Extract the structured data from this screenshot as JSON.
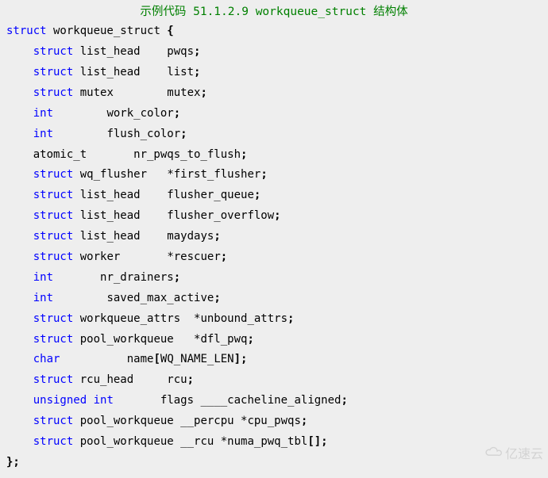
{
  "title": "示例代码 51.1.2.9 workqueue_struct 结构体",
  "lines": [
    {
      "tokens": [
        {
          "t": "struct",
          "c": "kw"
        },
        {
          "t": " workqueue_struct "
        },
        {
          "t": "{",
          "c": "punc"
        }
      ]
    },
    {
      "tokens": [
        {
          "t": "    "
        },
        {
          "t": "struct",
          "c": "kw"
        },
        {
          "t": " list_head    pwqs"
        },
        {
          "t": ";",
          "c": "punc"
        }
      ]
    },
    {
      "tokens": [
        {
          "t": "    "
        },
        {
          "t": "struct",
          "c": "kw"
        },
        {
          "t": " list_head    list"
        },
        {
          "t": ";",
          "c": "punc"
        }
      ]
    },
    {
      "tokens": [
        {
          "t": "    "
        },
        {
          "t": "struct",
          "c": "kw"
        },
        {
          "t": " mutex        mutex"
        },
        {
          "t": ";",
          "c": "punc"
        }
      ]
    },
    {
      "tokens": [
        {
          "t": "    "
        },
        {
          "t": "int",
          "c": "kw"
        },
        {
          "t": "        work_color"
        },
        {
          "t": ";",
          "c": "punc"
        }
      ]
    },
    {
      "tokens": [
        {
          "t": "    "
        },
        {
          "t": "int",
          "c": "kw"
        },
        {
          "t": "        flush_color"
        },
        {
          "t": ";",
          "c": "punc"
        }
      ]
    },
    {
      "tokens": [
        {
          "t": "    atomic_t       nr_pwqs_to_flush"
        },
        {
          "t": ";",
          "c": "punc"
        }
      ]
    },
    {
      "tokens": [
        {
          "t": "    "
        },
        {
          "t": "struct",
          "c": "kw"
        },
        {
          "t": " wq_flusher   "
        },
        {
          "t": "*",
          "c": "star"
        },
        {
          "t": "first_flusher"
        },
        {
          "t": ";",
          "c": "punc"
        }
      ]
    },
    {
      "tokens": [
        {
          "t": "    "
        },
        {
          "t": "struct",
          "c": "kw"
        },
        {
          "t": " list_head    flusher_queue"
        },
        {
          "t": ";",
          "c": "punc"
        }
      ]
    },
    {
      "tokens": [
        {
          "t": "    "
        },
        {
          "t": "struct",
          "c": "kw"
        },
        {
          "t": " list_head    flusher_overflow"
        },
        {
          "t": ";",
          "c": "punc"
        }
      ]
    },
    {
      "tokens": [
        {
          "t": "    "
        },
        {
          "t": "struct",
          "c": "kw"
        },
        {
          "t": " list_head    maydays"
        },
        {
          "t": ";",
          "c": "punc"
        }
      ]
    },
    {
      "tokens": [
        {
          "t": "    "
        },
        {
          "t": "struct",
          "c": "kw"
        },
        {
          "t": " worker       "
        },
        {
          "t": "*",
          "c": "star"
        },
        {
          "t": "rescuer"
        },
        {
          "t": ";",
          "c": "punc"
        }
      ]
    },
    {
      "tokens": [
        {
          "t": "    "
        },
        {
          "t": "int",
          "c": "kw"
        },
        {
          "t": "       nr_drainers"
        },
        {
          "t": ";",
          "c": "punc"
        }
      ]
    },
    {
      "tokens": [
        {
          "t": "    "
        },
        {
          "t": "int",
          "c": "kw"
        },
        {
          "t": "        saved_max_active"
        },
        {
          "t": ";",
          "c": "punc"
        }
      ]
    },
    {
      "tokens": [
        {
          "t": "    "
        },
        {
          "t": "struct",
          "c": "kw"
        },
        {
          "t": " workqueue_attrs  "
        },
        {
          "t": "*",
          "c": "star"
        },
        {
          "t": "unbound_attrs"
        },
        {
          "t": ";",
          "c": "punc"
        }
      ]
    },
    {
      "tokens": [
        {
          "t": "    "
        },
        {
          "t": "struct",
          "c": "kw"
        },
        {
          "t": " pool_workqueue   "
        },
        {
          "t": "*",
          "c": "star"
        },
        {
          "t": "dfl_pwq"
        },
        {
          "t": ";",
          "c": "punc"
        }
      ]
    },
    {
      "tokens": [
        {
          "t": "    "
        },
        {
          "t": "char",
          "c": "kw"
        },
        {
          "t": "          name"
        },
        {
          "t": "[",
          "c": "punc"
        },
        {
          "t": "WQ_NAME_LEN"
        },
        {
          "t": "];",
          "c": "punc"
        }
      ]
    },
    {
      "tokens": [
        {
          "t": "    "
        },
        {
          "t": "struct",
          "c": "kw"
        },
        {
          "t": " rcu_head     rcu"
        },
        {
          "t": ";",
          "c": "punc"
        }
      ]
    },
    {
      "tokens": [
        {
          "t": "    "
        },
        {
          "t": "unsigned",
          "c": "kw"
        },
        {
          "t": " "
        },
        {
          "t": "int",
          "c": "kw"
        },
        {
          "t": "       flags ____cacheline_aligned"
        },
        {
          "t": ";",
          "c": "punc"
        }
      ]
    },
    {
      "tokens": [
        {
          "t": "    "
        },
        {
          "t": "struct",
          "c": "kw"
        },
        {
          "t": " pool_workqueue __percpu "
        },
        {
          "t": "*",
          "c": "star"
        },
        {
          "t": "cpu_pwqs"
        },
        {
          "t": ";",
          "c": "punc"
        }
      ]
    },
    {
      "tokens": [
        {
          "t": "    "
        },
        {
          "t": "struct",
          "c": "kw"
        },
        {
          "t": " pool_workqueue __rcu "
        },
        {
          "t": "*",
          "c": "star"
        },
        {
          "t": "numa_pwq_tbl"
        },
        {
          "t": "[];",
          "c": "punc"
        }
      ]
    },
    {
      "tokens": [
        {
          "t": "};",
          "c": "punc"
        }
      ]
    }
  ],
  "watermark_text": "亿速云"
}
